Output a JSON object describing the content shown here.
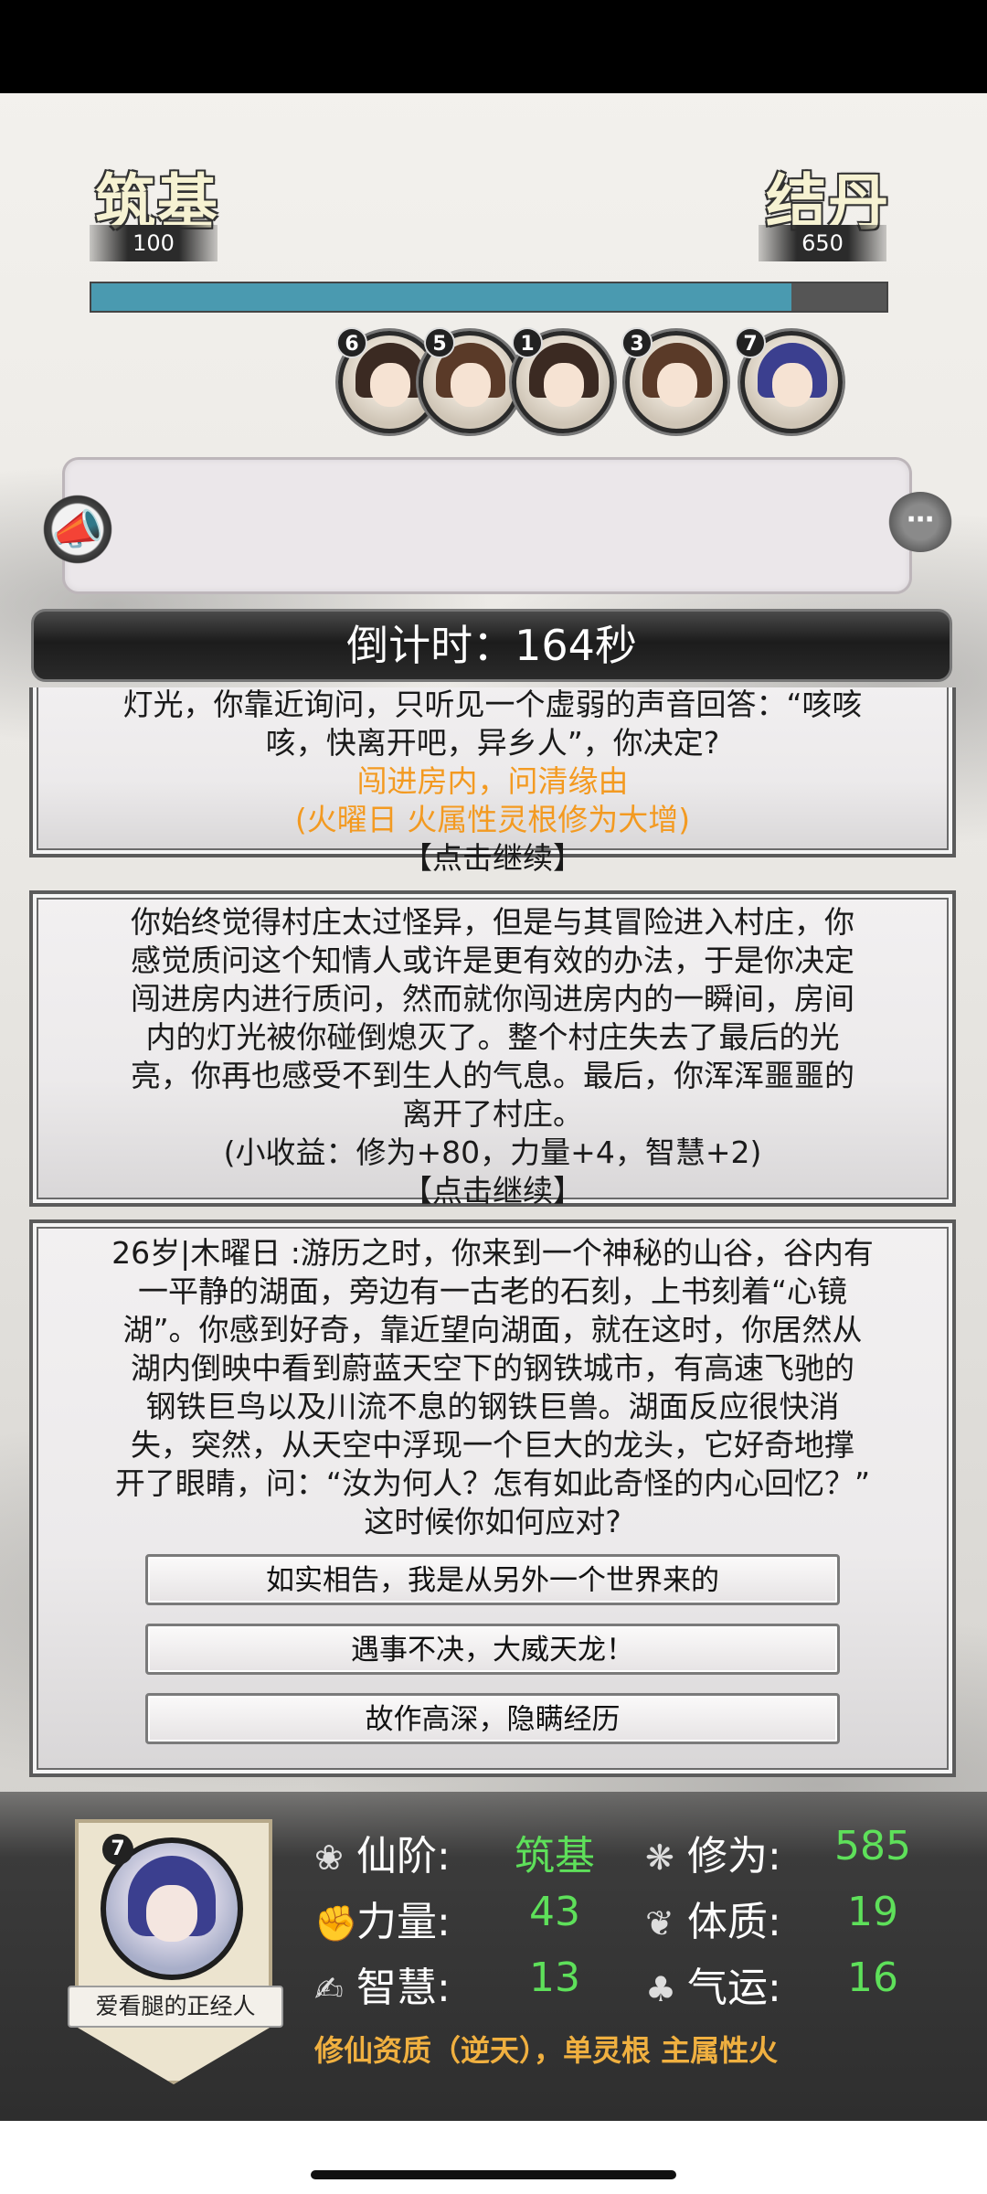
{
  "header": {
    "current_realm": "筑基",
    "current_value": "100",
    "next_realm": "结丹",
    "next_value": "650",
    "progress": 0.88
  },
  "party": [
    {
      "badge": "6",
      "hair": "#3b2a22"
    },
    {
      "badge": "5",
      "hair": "#5a3a28"
    },
    {
      "badge": "1",
      "hair": "#3b2a22"
    },
    {
      "badge": "3",
      "hair": "#5a3a28"
    },
    {
      "badge": "7",
      "hair": "#3b3f8f"
    }
  ],
  "countdown": "倒计时：164秒",
  "story": {
    "card1": {
      "line1": "灯光，你靠近询问，只听见一个虚弱的声音回答：“咳咳",
      "line2": "咳，快离开吧，异乡人”，你决定?",
      "choice": "闯进房内，问清缘由",
      "effect": "(火曜日 火属性灵根修为大增)",
      "continue": "【点击继续】"
    },
    "card2": {
      "lines": [
        "你始终觉得村庄太过怪异，但是与其冒险进入村庄，你",
        "感觉质问这个知情人或许是更有效的办法，于是你决定",
        "闯进房内进行质问，然而就你闯进房内的一瞬间，房间",
        "内的灯光被你碰倒熄灭了。整个村庄失去了最后的光",
        "亮，你再也感受不到生人的气息。最后，你浑浑噩噩的",
        "离开了村庄。"
      ],
      "reward": "(小收益：修为+80，力量+4，智慧+2)",
      "continue": "【点击继续】"
    },
    "card3": {
      "lines": [
        "26岁|木曜日 :游历之时，你来到一个神秘的山谷，谷内有",
        "一平静的湖面，旁边有一古老的石刻，上书刻着“心镜",
        "湖”。你感到好奇，靠近望向湖面，就在这时，你居然从",
        "湖内倒映中看到蔚蓝天空下的钢铁城市，有高速飞驰的",
        "钢铁巨鸟以及川流不息的钢铁巨兽。湖面反应很快消",
        "失，突然，从天空中浮现一个巨大的龙头，它好奇地撑",
        "开了眼睛，问：“汝为何人？怎有如此奇怪的内心回忆？”",
        "这时候你如何应对?"
      ],
      "options": [
        "如实相告，我是从另外一个世界来的",
        "遇事不决，大威天龙！",
        "故作高深，隐瞒经历"
      ]
    }
  },
  "player": {
    "badge": "7",
    "name": "爱看腿的正经人",
    "stats": {
      "rank_label": "仙阶:",
      "rank_value": "筑基",
      "cultivation_label": "修为:",
      "cultivation_value": "585",
      "strength_label": "力量:",
      "strength_value": "43",
      "physique_label": "体质:",
      "physique_value": "19",
      "wisdom_label": "智慧:",
      "wisdom_value": "13",
      "luck_label": "气运:",
      "luck_value": "16"
    },
    "aptitude": "修仙资质（逆天），单灵根 主属性火"
  },
  "colors": {
    "progress": "#4a9ab0",
    "stat_value": "#5ee05a",
    "highlight": "#f39a21",
    "aptitude": "#f0b040"
  }
}
